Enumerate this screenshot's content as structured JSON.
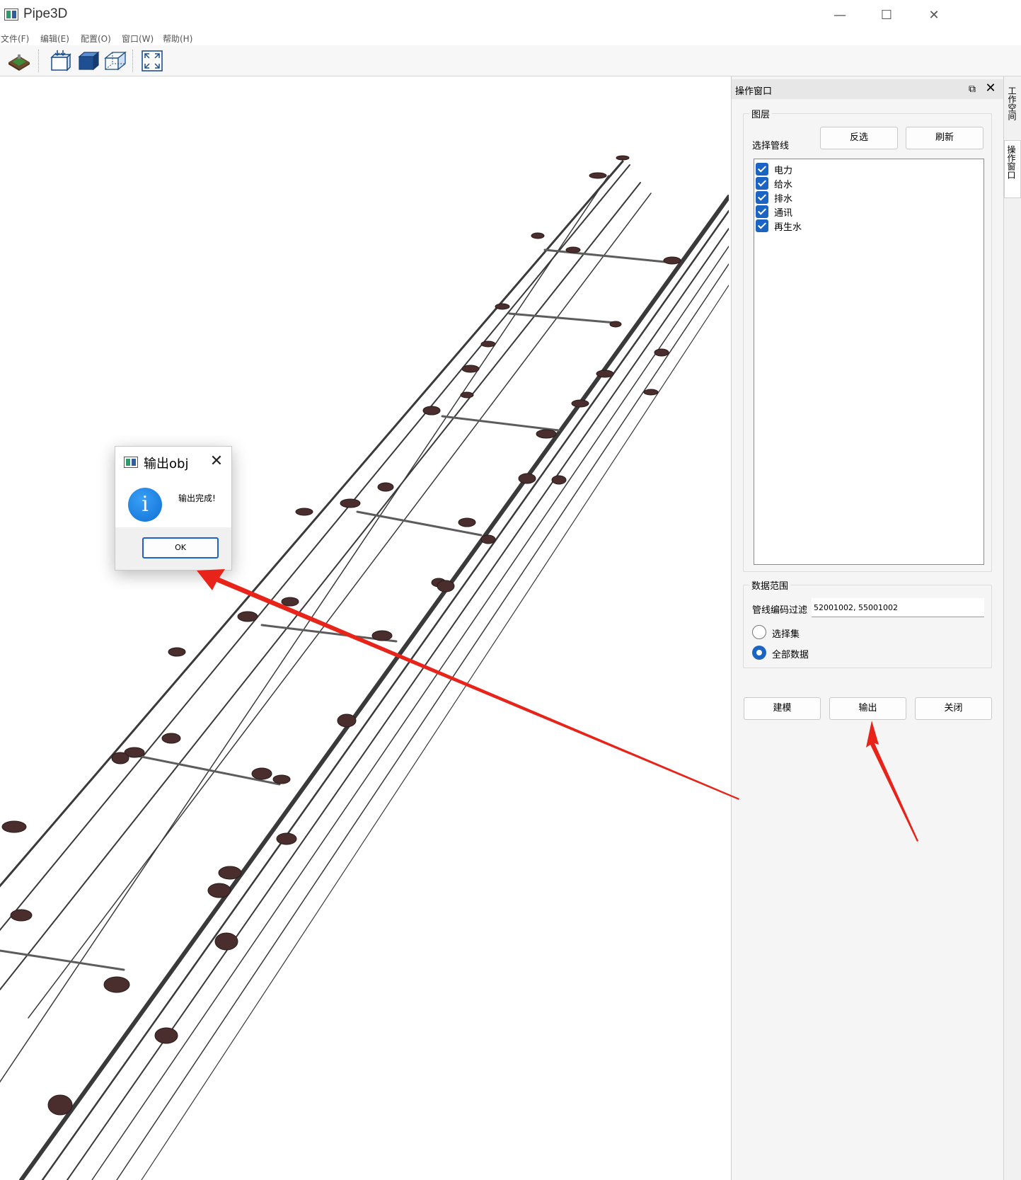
{
  "window": {
    "title": "Pipe3D",
    "minimize_glyph": "—",
    "maximize_glyph": "☐",
    "close_glyph": "✕"
  },
  "menu": [
    "文件(F)",
    "编辑(E)",
    "配置(O)",
    "窗口(W)",
    "帮助(H)"
  ],
  "toolbar": {
    "buttons": [
      "terrain-icon",
      "model-box-icon",
      "solid-cube-icon",
      "wire-cube-icon",
      "fit-view-icon"
    ]
  },
  "dock": {
    "title": "操作窗口",
    "float_glyph": "⧉",
    "close_glyph": "✕",
    "layers_group": {
      "title": "图层",
      "select_label": "选择管线",
      "invert_button": "反选",
      "refresh_button": "刷新",
      "items": [
        {
          "label": "电力",
          "checked": true
        },
        {
          "label": "给水",
          "checked": true
        },
        {
          "label": "排水",
          "checked": true
        },
        {
          "label": "通讯",
          "checked": true
        },
        {
          "label": "再生水",
          "checked": true
        }
      ]
    },
    "range_group": {
      "title": "数据范围",
      "filter_label": "管线编码过滤",
      "filter_value": "52001002, 55001002",
      "radio_selection": "选择集",
      "radio_all": "全部数据",
      "selected": "全部数据"
    },
    "actions": {
      "build": "建模",
      "export": "输出",
      "close": "关闭"
    }
  },
  "side_tabs": [
    {
      "label": "工作空间",
      "active": false
    },
    {
      "label": "操作窗口",
      "active": true
    }
  ],
  "dialog": {
    "title": "输出obj",
    "close_glyph": "✕",
    "icon": "information-icon",
    "icon_glyph": "i",
    "message": "输出完成!",
    "ok_button": "OK"
  },
  "colors": {
    "accent": "#1b64c4",
    "annotation_arrow": "#e8231a",
    "pipe": "#3a3a3a",
    "manhole": "#4a2e2e"
  }
}
